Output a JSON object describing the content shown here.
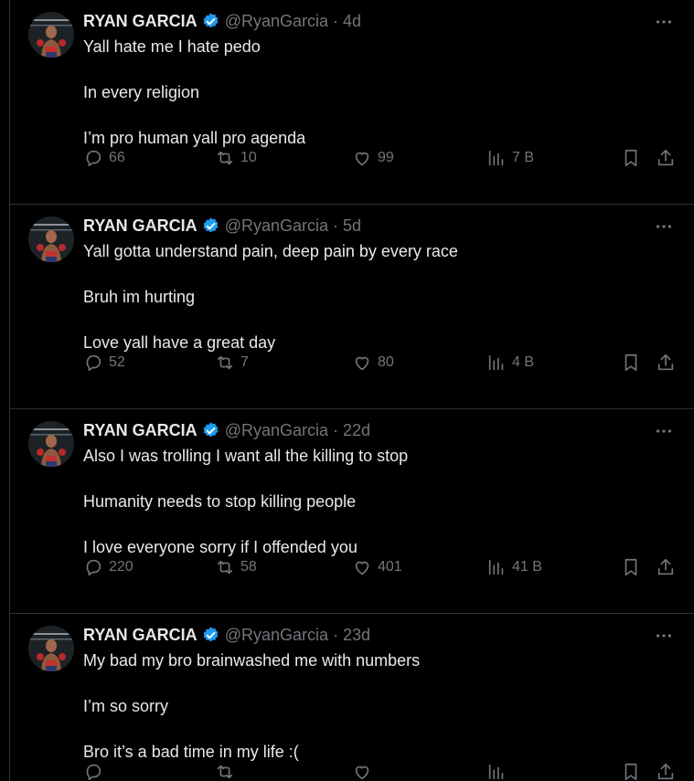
{
  "colors": {
    "background": "#000000",
    "text_primary": "#e7e9ea",
    "text_secondary": "#71767b",
    "divider": "#2f3336",
    "verified_badge": "#1d9bf0"
  },
  "icons": {
    "reply": "speech-bubble-icon",
    "retweet": "retweet-arrows-icon",
    "like": "heart-icon",
    "views": "bar-chart-icon",
    "bookmark": "bookmark-icon",
    "share": "share-upload-icon",
    "more": "three-dots-icon",
    "verified": "verified-badge-icon"
  },
  "tweets": [
    {
      "author": "RYAN GARCIA",
      "handle": "@RyanGarcia",
      "separator": "·",
      "time": "4d",
      "lines": [
        "Yall hate me I hate pedo",
        "In every religion",
        "I’m pro human yall pro agenda"
      ],
      "replies": "66",
      "retweets": "10",
      "likes": "99",
      "views": "7 В"
    },
    {
      "author": "RYAN GARCIA",
      "handle": "@RyanGarcia",
      "separator": "·",
      "time": "5d",
      "lines": [
        "Yall gotta understand pain, deep pain by every race",
        "Bruh im hurting",
        "Love yall have a great day"
      ],
      "replies": "52",
      "retweets": "7",
      "likes": "80",
      "views": "4 В"
    },
    {
      "author": "RYAN GARCIA",
      "handle": "@RyanGarcia",
      "separator": "·",
      "time": "22d",
      "lines": [
        "Also I was trolling I want all the killing to stop",
        "Humanity needs to stop killing people",
        "I love everyone sorry if I offended you"
      ],
      "replies": "220",
      "retweets": "58",
      "likes": "401",
      "views": "41 В"
    },
    {
      "author": "RYAN GARCIA",
      "handle": "@RyanGarcia",
      "separator": "·",
      "time": "23d",
      "lines": [
        "My bad my bro brainwashed me with numbers",
        "I’m so sorry",
        "Bro it’s a bad time in my life :("
      ],
      "replies": "",
      "retweets": "",
      "likes": "",
      "views": ""
    }
  ]
}
